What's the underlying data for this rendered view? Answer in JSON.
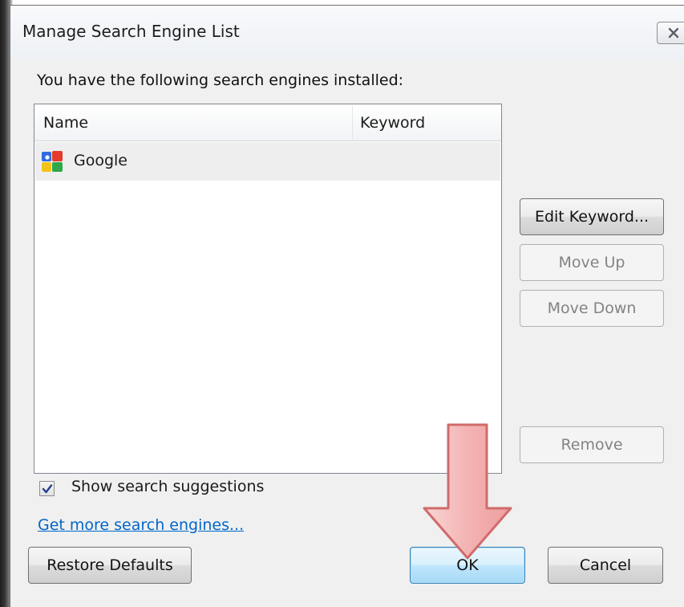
{
  "window": {
    "title": "Manage Search Engine List"
  },
  "intro_text": "You have the following search engines installed:",
  "list": {
    "columns": [
      "Name",
      "Keyword"
    ],
    "rows": [
      {
        "name": "Google",
        "keyword": "",
        "icon": "google-icon"
      }
    ]
  },
  "side_buttons": {
    "edit_keyword": "Edit Keyword...",
    "move_up": "Move Up",
    "move_down": "Move Down",
    "remove": "Remove"
  },
  "options": {
    "show_suggestions_label": "Show search suggestions",
    "show_suggestions_checked": true,
    "more_engines_link": "Get more search engines..."
  },
  "footer_buttons": {
    "restore_defaults": "Restore Defaults",
    "ok": "OK",
    "cancel": "Cancel"
  },
  "annotation": {
    "icon": "down-arrow-icon",
    "color": "#f4b3b3"
  },
  "colors": {
    "dialog_bg": "#f0f0f0",
    "link": "#0066cc",
    "default_button": "#bee6fd"
  }
}
